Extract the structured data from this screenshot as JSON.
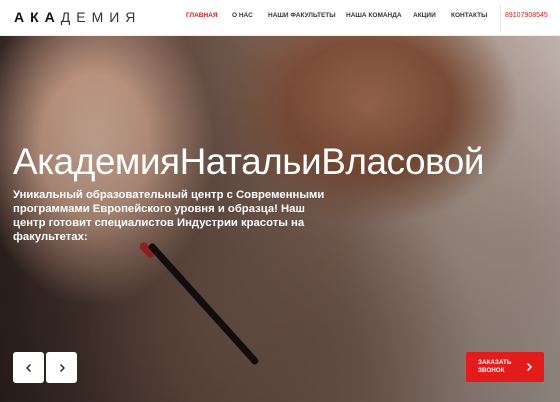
{
  "header": {
    "logo_bold": "АКА",
    "logo_light": "ДЕМИЯ",
    "nav": [
      {
        "label": "ГЛАВНАЯ",
        "active": true
      },
      {
        "label": "О НАС",
        "active": false
      },
      {
        "label": "НАШИ ФАКУЛЬТЕТЫ",
        "active": false
      },
      {
        "label": "НАША КОМАНДА",
        "active": false
      },
      {
        "label": "АКЦИИ",
        "active": false
      },
      {
        "label": "КОНТАКТЫ",
        "active": false
      }
    ],
    "phone": "89107908545"
  },
  "hero": {
    "title": "АкадемияНатальиВласовой",
    "description": "Уникальный образовательный центр с Современными программами Европейского уровня и образца! Наш центр готовит специалистов Индустрии красоты на факультетах:",
    "prev_icon": "chevron-left-icon",
    "next_icon": "chevron-right-icon",
    "cta_label": "ЗАКАЗАТЬ ЗВОНОК",
    "cta_icon": "chevron-right-icon"
  },
  "colors": {
    "accent": "#e21b1b",
    "text_dark": "#333333",
    "white": "#ffffff"
  }
}
